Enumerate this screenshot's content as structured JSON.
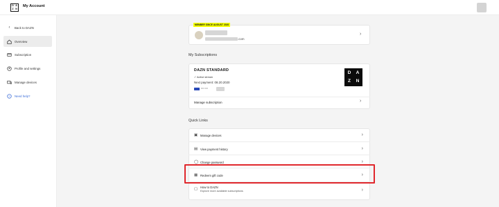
{
  "header": {
    "logo_letters": [
      "D",
      "A",
      "Z",
      "N"
    ],
    "title": "My Account"
  },
  "sidebar": {
    "items": [
      {
        "label": "Back to DAZN",
        "icon": "chevron-left-icon"
      },
      {
        "label": "Overview",
        "icon": "home-icon",
        "active": true
      },
      {
        "label": "Subscription",
        "icon": "card-icon"
      },
      {
        "label": "Profile and settings",
        "icon": "user-icon"
      },
      {
        "label": "Manage devices",
        "icon": "devices-icon"
      },
      {
        "label": "Need help?",
        "icon": "help-icon"
      }
    ]
  },
  "profile": {
    "badge": "MEMBER SINCE AUGUST 2020",
    "email_suffix": ".com"
  },
  "subscriptions": {
    "title": "My Subscriptions",
    "plan_name": "DAZN STANDARD",
    "status": "✓ Active stream",
    "next_payment": "Next payment: 08.20.2020",
    "card_masked": "•••• ••••",
    "plan_logo_letters": [
      "D",
      "A",
      "Z",
      "N"
    ],
    "manage_label": "Manage subscription"
  },
  "quick_links": {
    "title": "Quick Links",
    "items": [
      {
        "label": "Manage devices",
        "icon": "devices-icon"
      },
      {
        "label": "View payment history",
        "icon": "receipt-icon"
      },
      {
        "label": "Change password",
        "icon": "lock-icon"
      },
      {
        "label": "Redeem gift code",
        "icon": "gift-icon"
      },
      {
        "label": "How to DAZN",
        "sub": "Explore more available subscriptions",
        "icon": "tv-icon"
      }
    ]
  },
  "colors": {
    "accent": "#f4ff00",
    "highlight": "#e0262b",
    "link": "#3b6cd8",
    "background": "#f4f4f4"
  }
}
